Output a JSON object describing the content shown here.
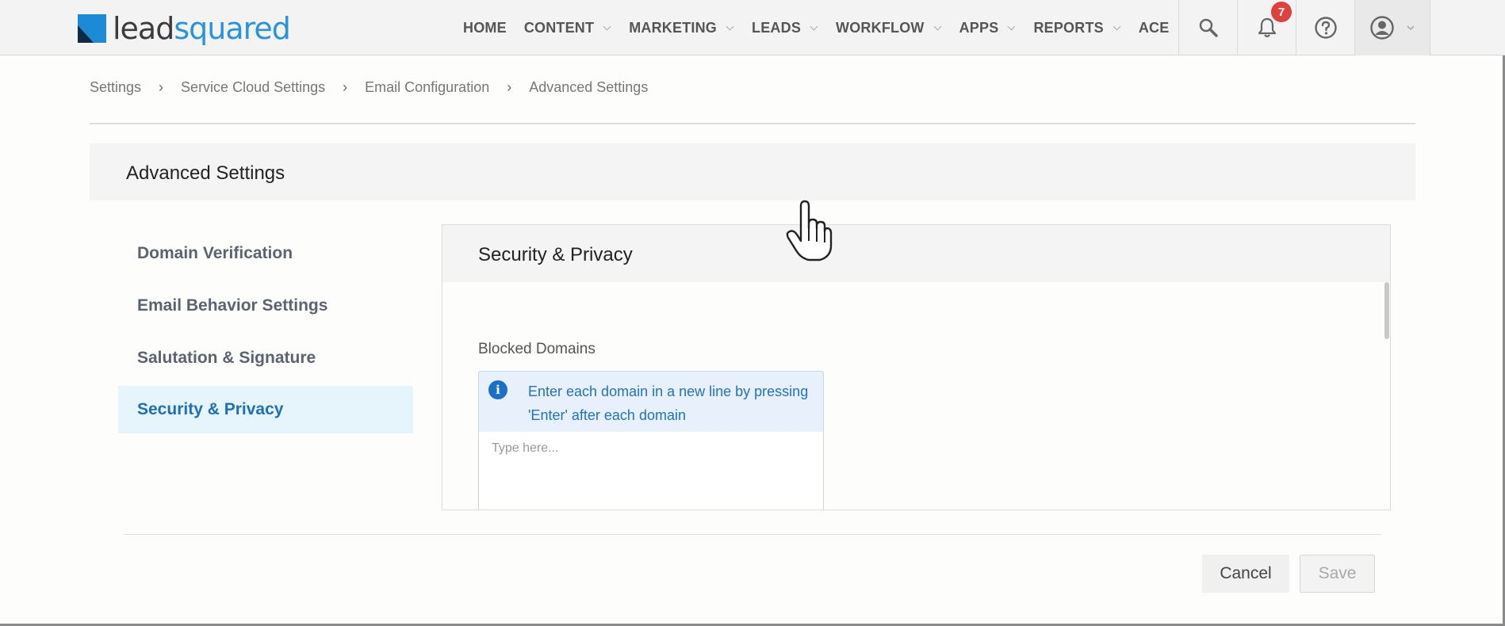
{
  "brand": {
    "logo_part1": "lead",
    "logo_part2": "squared",
    "primary_color": "#2a93de",
    "dark_color": "#0f2a44"
  },
  "nav": {
    "items": [
      {
        "label": "HOME",
        "has_dropdown": false
      },
      {
        "label": "CONTENT",
        "has_dropdown": true
      },
      {
        "label": "MARKETING",
        "has_dropdown": true
      },
      {
        "label": "LEADS",
        "has_dropdown": true
      },
      {
        "label": "WORKFLOW",
        "has_dropdown": true
      },
      {
        "label": "APPS",
        "has_dropdown": true
      },
      {
        "label": "REPORTS",
        "has_dropdown": true
      },
      {
        "label": "ACE",
        "has_dropdown": false
      }
    ],
    "icons": [
      "search-icon",
      "bell-icon",
      "help-icon",
      "user-icon"
    ],
    "notification_count": "7",
    "badge_color": "#e0413e"
  },
  "breadcrumb": [
    "Settings",
    "Service Cloud Settings",
    "Email Configuration",
    "Advanced Settings"
  ],
  "page": {
    "title": "Advanced Settings"
  },
  "sidebar": {
    "items": [
      {
        "label": "Domain Verification",
        "active": false
      },
      {
        "label": "Email Behavior Settings",
        "active": false
      },
      {
        "label": "Salutation & Signature",
        "active": false
      },
      {
        "label": "Security & Privacy",
        "active": true
      }
    ],
    "active_color": "#1f6fb8"
  },
  "panel": {
    "title": "Security & Privacy",
    "blocked_domains_label": "Blocked Domains",
    "info_text": "Enter each domain in a new line by pressing 'Enter' after each domain",
    "textarea_value": "",
    "textarea_placeholder": "Type here..."
  },
  "footer": {
    "cancel_label": "Cancel",
    "save_label": "Save"
  }
}
